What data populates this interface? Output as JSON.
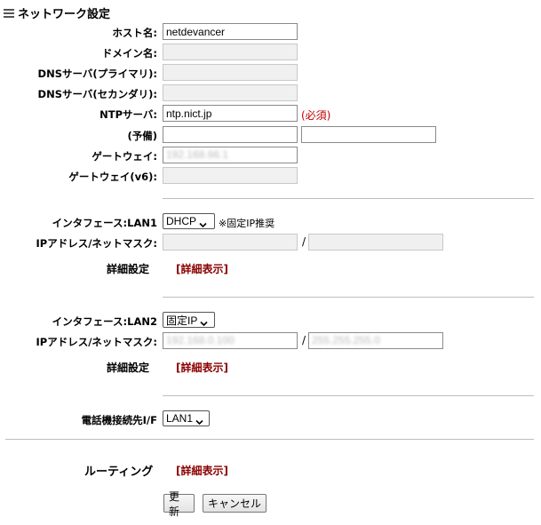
{
  "title": "ネットワーク設定",
  "fields": {
    "hostname": {
      "label": "ホスト名:",
      "value": "netdevancer"
    },
    "domain": {
      "label": "ドメイン名:",
      "value": ""
    },
    "dns_primary": {
      "label": "DNSサーバ(プライマリ):",
      "value": ""
    },
    "dns_secondary": {
      "label": "DNSサーバ(セカンダリ):",
      "value": ""
    },
    "ntp": {
      "label": "NTPサーバ:",
      "value": "ntp.nict.jp",
      "required_note": "(必須)"
    },
    "backup": {
      "label": "(予備)",
      "value1": "",
      "value2": ""
    },
    "gateway": {
      "label": "ゲートウェイ:",
      "value": "192.168.66.1"
    },
    "gateway_v6": {
      "label": "ゲートウェイ(v6):",
      "value": ""
    }
  },
  "lan1": {
    "interface_label": "インタフェース:LAN1",
    "mode": "DHCP",
    "note": "※固定IP推奨",
    "ip_mask_label": "IPアドレス/ネットマスク:",
    "ip": "",
    "mask": "",
    "slash": "/",
    "detail_label": "詳細設定",
    "detail_link": "[詳細表示]"
  },
  "lan2": {
    "interface_label": "インタフェース:LAN2",
    "mode": "固定IP",
    "ip_mask_label": "IPアドレス/ネットマスク:",
    "ip": "192.168.0.100",
    "mask": "255.255.255.0",
    "slash": "/",
    "detail_label": "詳細設定",
    "detail_link": "[詳細表示]"
  },
  "phone": {
    "label": "電話機接続先I/F",
    "value": "LAN1"
  },
  "routing": {
    "label": "ルーティング",
    "detail_link": "[詳細表示]"
  },
  "buttons": {
    "update": "更新",
    "cancel": "キャンセル"
  }
}
